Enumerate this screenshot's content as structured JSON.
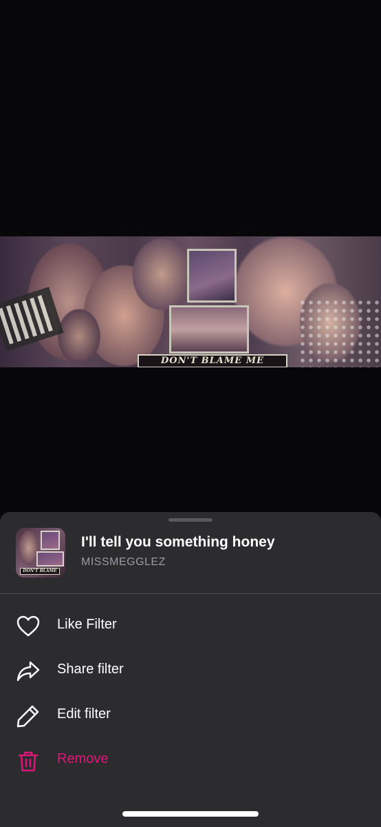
{
  "banner": {
    "caption": "DON'T BLAME ME"
  },
  "sheet": {
    "filter_title": "I'll tell you something honey",
    "author": "MISSMEGGLEZ",
    "thumbnail_caption": "DON'T BLAME",
    "menu": [
      {
        "label": "Like Filter",
        "icon": "heart-icon"
      },
      {
        "label": "Share filter",
        "icon": "share-arrow-icon"
      },
      {
        "label": "Edit filter",
        "icon": "pencil-icon"
      },
      {
        "label": "Remove",
        "icon": "trash-icon"
      }
    ],
    "colors": {
      "sheet_bg": "#2c2c2e",
      "danger": "#e0157a",
      "text": "#ffffff",
      "muted": "#9a9aa0"
    }
  }
}
